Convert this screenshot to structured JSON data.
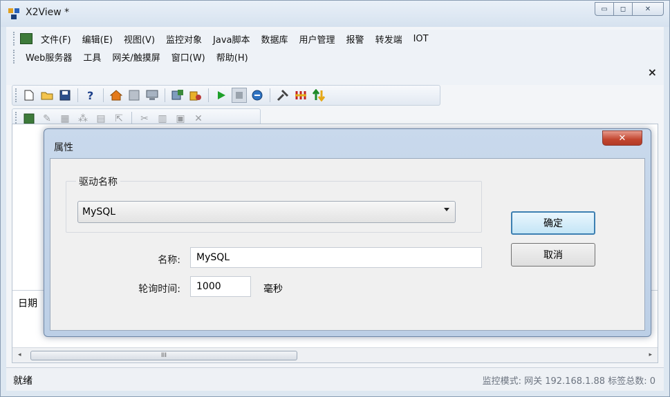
{
  "window": {
    "title": "X2View *",
    "caption_min": "▭",
    "caption_max": "◻",
    "caption_close": "✕"
  },
  "menu": {
    "row1": [
      "文件(F)",
      "编辑(E)",
      "视图(V)",
      "监控对象",
      "Java脚本",
      "数据库",
      "用户管理",
      "报警",
      "转发端",
      "IOT"
    ],
    "row2": [
      "Web服务器",
      "工具",
      "网关/触摸屏",
      "窗口(W)",
      "帮助(H)"
    ],
    "mdi_close": "×"
  },
  "toolbar1": {
    "icons": [
      "new-file-icon",
      "open-folder-icon",
      "save-icon",
      "help-icon",
      "home-icon",
      "tile-icon",
      "monitor-icon",
      "config-icon",
      "tag-icon",
      "play-icon",
      "stop-icon",
      "refresh-icon",
      "tools-icon",
      "load-icon",
      "transfer-icon"
    ]
  },
  "log": {
    "date_col": "日期"
  },
  "scrollbar": {
    "thumb_grip": "III",
    "left_arrow": "◂",
    "right_arrow": "▸"
  },
  "status": {
    "left": "就绪",
    "right": "监控模式: 网关 192.168.1.88 标签总数: 0"
  },
  "dialog": {
    "title": "属性",
    "close_glyph": "✕",
    "driver_group_label": "驱动名称",
    "driver_value": "MySQL",
    "name_label": "名称:",
    "name_value": "MySQL",
    "poll_label": "轮询时间:",
    "poll_value": "1000",
    "poll_unit": "毫秒",
    "ok_label": "确定",
    "cancel_label": "取消"
  }
}
